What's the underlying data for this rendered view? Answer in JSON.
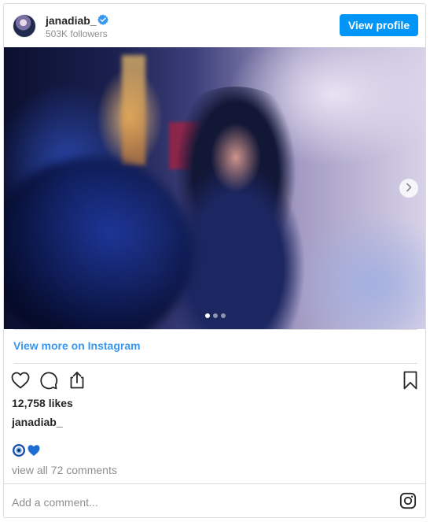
{
  "header": {
    "username": "janadiab_",
    "followers": "503K followers",
    "view_profile": "View profile"
  },
  "post": {
    "view_more": "View more on Instagram",
    "likes": "12,758 likes",
    "caption_user": "janadiab_",
    "emojis": [
      "blue-eye-emoji",
      "blue-heart-emoji"
    ],
    "view_comments": "view all 72 comments",
    "add_comment_placeholder": "Add a comment...",
    "carousel": {
      "slide_count": 3,
      "active_slide": 1
    }
  },
  "icons": {
    "verified": "verified-badge-icon",
    "next": "chevron-right-icon",
    "like": "heart-icon",
    "comment": "comment-icon",
    "share": "share-icon",
    "save": "bookmark-icon",
    "instagram": "instagram-logo-icon"
  },
  "colors": {
    "accent": "#0095f6",
    "link": "#3897f0",
    "muted": "#8e8e8e",
    "text": "#262626",
    "border": "#dbdbdb"
  }
}
